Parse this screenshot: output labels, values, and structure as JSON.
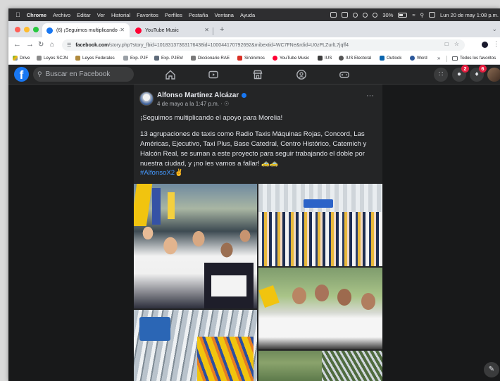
{
  "menubar": {
    "apple": "",
    "items": [
      "Chrome",
      "Archivo",
      "Editar",
      "Ver",
      "Historial",
      "Favoritos",
      "Perfiles",
      "Pestaña",
      "Ventana",
      "Ayuda"
    ],
    "battery": "30%",
    "clock": "Lun 20 de may  1:08 p.m."
  },
  "tabs": [
    {
      "title": "(6) ¡Seguimos multiplicando ·",
      "active": true
    },
    {
      "title": "YouTube Music",
      "active": false
    }
  ],
  "toolbar": {
    "url_host": "facebook.com",
    "url_rest": "/story.php?story_fbid=10183137363176438id=100044170792692&mibextid=WC7FNe&rdid=U0zPLZurlL7jqff4"
  },
  "bookmarks": [
    "Drive",
    "Leyes SCJN",
    "Leyes Federales",
    "Exp. PJF",
    "Exp. PJEM",
    "Diccionario RAE",
    "Sinónimos",
    "YouTube Music",
    "IUS",
    "IUS Electoral",
    "Outlook",
    "Word"
  ],
  "bookmarks_more": "»",
  "bookmarks_all": "Todos los favoritos",
  "facebook": {
    "logo": "f",
    "search_placeholder": "Buscar en Facebook",
    "messenger_badge": "2",
    "notifications_badge": "6"
  },
  "post": {
    "author": "Alfonso Martínez Alcázar",
    "date": "4 de mayo a la 1:47 p.m. · ",
    "more": "···",
    "headline": "¡Seguimos multiplicando el apoyo para Morelia!",
    "body": "13 agrupaciones de taxis como Radio Taxis Máquinas Rojas, Concord, Las Américas, Ejecutivo, Taxi Plus, Base Catedral, Centro Histórico, Catemich y Halcón Real, se suman a este proyecto para seguir trabajando el doble por nuestra ciudad, y ¡no les vamos a fallar! 🚕🚕",
    "hashtag": "#AlfonsoX2✌"
  },
  "colors": {
    "facebook_blue": "#1877f2",
    "fb_bg": "#18191a",
    "card_bg": "#242526",
    "badge_red": "#e41e3f",
    "link_blue": "#4599ff"
  },
  "icons": [
    "apple-icon",
    "wifi-icon",
    "bluetooth-icon",
    "search-icon",
    "home-icon",
    "video-icon",
    "marketplace-icon",
    "groups-icon",
    "gaming-icon",
    "grid-menu-icon",
    "messenger-icon",
    "bell-icon",
    "edit-icon"
  ]
}
